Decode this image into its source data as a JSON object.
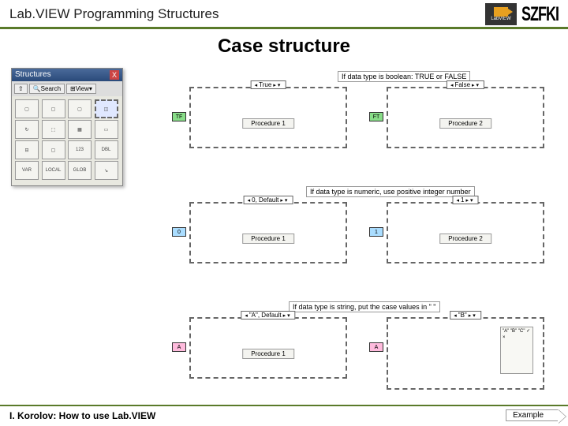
{
  "header": {
    "title": "Lab.VIEW Programming Structures",
    "logo_lv_text": "LabVIEW",
    "logo_szfki": "SZFKI"
  },
  "main_title": "Case structure",
  "palette": {
    "title": "Structures",
    "close": "X",
    "btn_up": "⇧",
    "btn_search": "🔍Search",
    "btn_view": "⊞View▾",
    "items": [
      "▢",
      "▢",
      "▢",
      "◫",
      "↻",
      "⬚",
      "▦",
      "▭",
      "⊟",
      "▢",
      "123",
      "DBL",
      "VAR",
      "LOCAL",
      "GLOB",
      "↘"
    ]
  },
  "notes": {
    "n1": "If data type is boolean: TRUE or FALSE",
    "n2": "If data type is numeric, use positive integer number",
    "n3": "If data type is string, put the case values in \" \""
  },
  "cases": {
    "c1": {
      "tab": "True",
      "inner": "Procedure 1",
      "term": "TF"
    },
    "c2": {
      "tab": "False",
      "inner": "Procedure 2",
      "term": "FT"
    },
    "c3": {
      "tab": "0, Default",
      "inner": "Procedure 1",
      "term": "0"
    },
    "c4": {
      "tab": "1",
      "inner": "Procedure 2",
      "term": "1"
    },
    "c5": {
      "tab": "\"A\", Default",
      "inner": "Procedure 1",
      "term": "A"
    },
    "c6": {
      "tab": "\"B\"",
      "inner": "",
      "term": "A"
    }
  },
  "enum_list": "\"A\"\n\"B\"\n\"C\"\n✓\n×",
  "footer": {
    "text": "I. Korolov: How to use Lab.VIEW",
    "example": "Example"
  }
}
